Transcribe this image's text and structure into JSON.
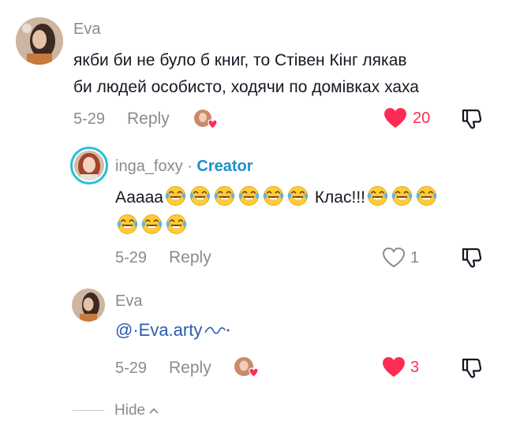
{
  "comments": [
    {
      "author": "Eva",
      "text_line1": "якби би не було б книг, то Стівен Кінг лякав",
      "text_line2": "би людей особисто, ходячи по домівках хаха",
      "date": "5-29",
      "reply_label": "Reply",
      "likes": "20",
      "liked_by_creator": true
    }
  ],
  "replies": [
    {
      "author": "inga_foxy",
      "separator": "·",
      "badge": "Creator",
      "text_prefix": "Ааааа",
      "text_middle": "Клас!!!",
      "emoji_name": "face-with-tears-of-joy",
      "emoji_count_line1_before": 6,
      "emoji_count_line1_after": 3,
      "emoji_count_line2": 3,
      "date": "5-29",
      "reply_label": "Reply",
      "likes": "1"
    },
    {
      "author": "Eva",
      "mention": "@·Eva.arty",
      "date": "5-29",
      "reply_label": "Reply",
      "likes": "3",
      "liked_by_creator": true
    }
  ],
  "footer": {
    "hide_label": "Hide"
  },
  "colors": {
    "like_red": "#fe2c55",
    "creator_blue": "#1e8fc8",
    "ring_cyan": "#25c3d6",
    "meta_gray": "#8a8b91"
  }
}
